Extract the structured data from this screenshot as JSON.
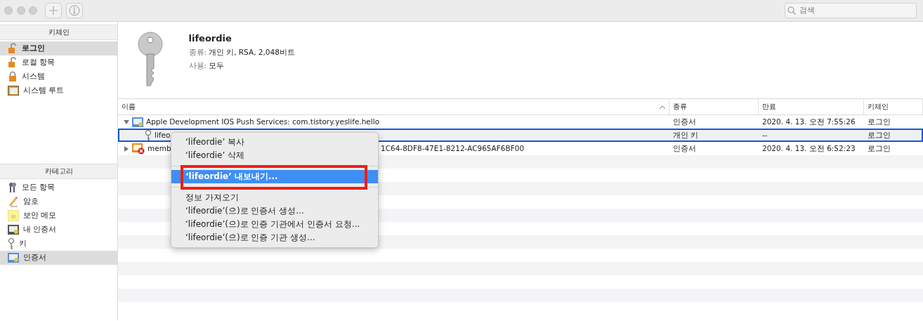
{
  "toolbar": {
    "search": {
      "placeholder": "검색"
    }
  },
  "sidebar": {
    "keychains": {
      "title": "키체인",
      "items": [
        {
          "label": "로그인",
          "selected": true
        },
        {
          "label": "로컬 항목",
          "selected": false
        },
        {
          "label": "시스템",
          "selected": false
        },
        {
          "label": "시스템 루트",
          "selected": false
        }
      ]
    },
    "categories": {
      "title": "카테고리",
      "items": [
        {
          "label": "모든 항목",
          "selected": false
        },
        {
          "label": "암호",
          "selected": false
        },
        {
          "label": "보안 메모",
          "selected": false
        },
        {
          "label": "내 인증서",
          "selected": false
        },
        {
          "label": "키",
          "selected": false
        },
        {
          "label": "인증서",
          "selected": true
        }
      ]
    }
  },
  "detail": {
    "name": "lifeordie",
    "lines": [
      {
        "label": "종류:",
        "value": "개인 키, RSA, 2,048비트"
      },
      {
        "label": "사용:",
        "value": "모두"
      }
    ]
  },
  "table": {
    "columns": [
      "이름",
      "종류",
      "만료",
      "키체인"
    ],
    "rows": [
      {
        "kind": "cert",
        "expanded": true,
        "name": "Apple Development IOS Push Services: com.tistory.yeslife.hello",
        "name_tail": "",
        "type": "인증서",
        "expires": "2020. 4. 13. 오전 7:55:26",
        "keychain": "로그인",
        "selected": false
      },
      {
        "kind": "key",
        "name": "lifeo",
        "name_tail": "",
        "type": "개인 키",
        "expires": "--",
        "keychain": "로그인",
        "selected": true
      },
      {
        "kind": "cert-invalid",
        "expanded": false,
        "name": "memb",
        "name_tail": "1C64-8DF8-47E1-8212-AC965AF6BF00",
        "type": "인증서",
        "expires": "2020. 4. 13. 오전 6:52:23",
        "keychain": "로그인",
        "selected": false
      }
    ]
  },
  "context_menu": {
    "groups": [
      [
        {
          "label": "‘lifeordie’ 복사",
          "selected": false
        },
        {
          "label": "‘lifeordie’ 삭제",
          "selected": false
        }
      ],
      [
        {
          "label": "‘lifeordie’ 내보내기...",
          "selected": true,
          "highlighted": true
        }
      ],
      [
        {
          "label": "정보 가져오기",
          "selected": false
        },
        {
          "label": "‘lifeordie’(으)로 인증서 생성...",
          "selected": false
        },
        {
          "label": "‘lifeordie’(으)로 인증 기관에서 인증서 요청...",
          "selected": false
        },
        {
          "label": "‘lifeordie’(으)로 인증 기관 생성...",
          "selected": false
        }
      ]
    ]
  }
}
